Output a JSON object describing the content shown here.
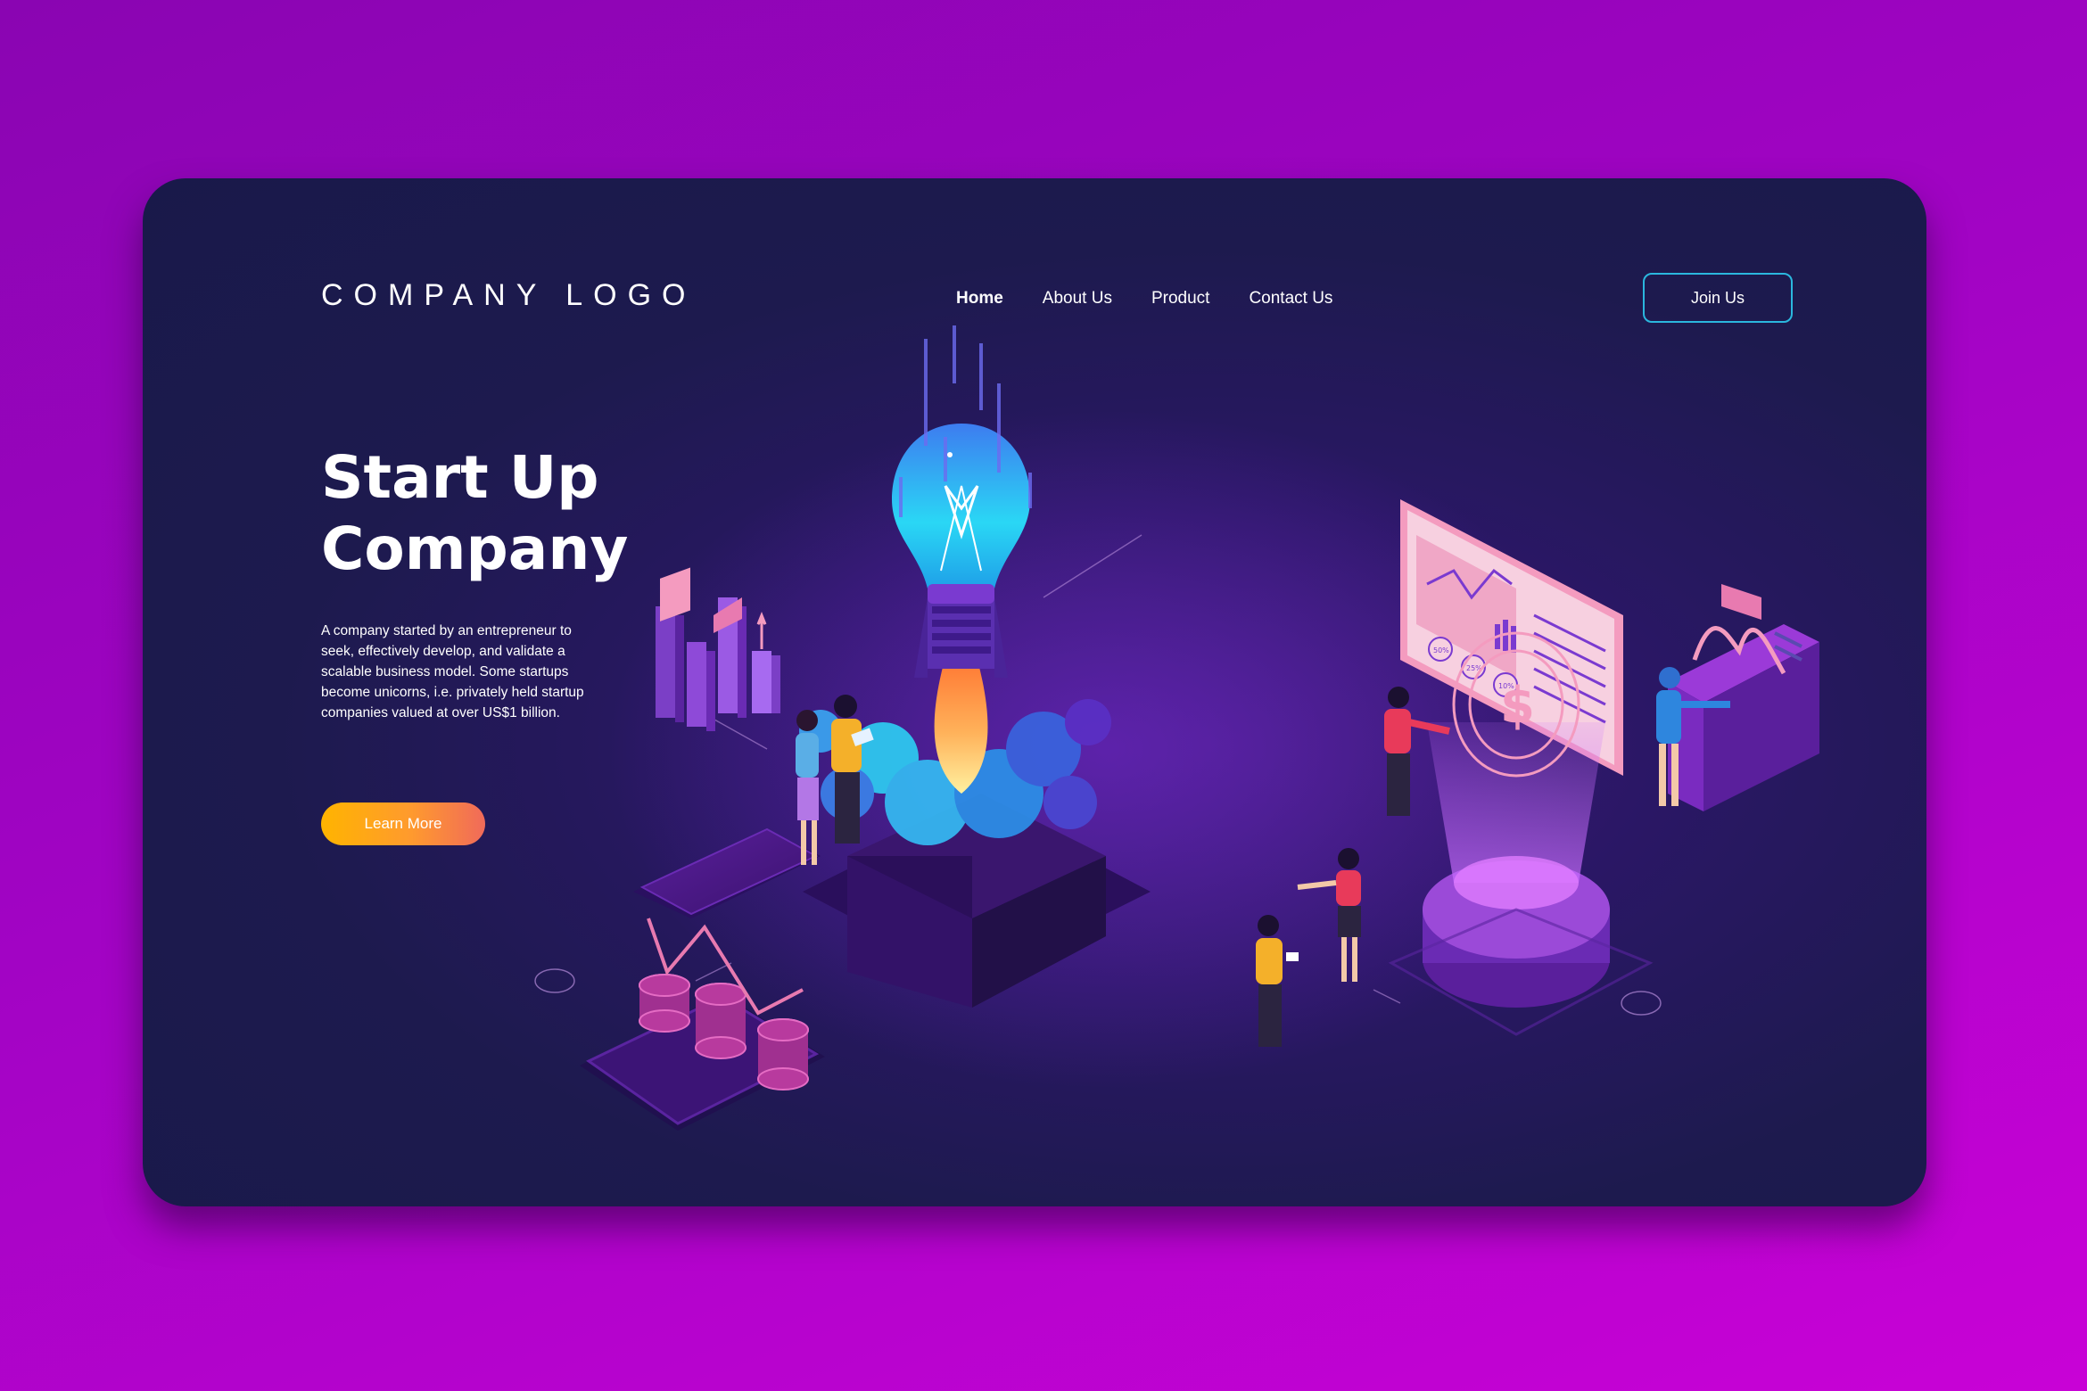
{
  "brand": {
    "logo_text": "COMPANY LOGO"
  },
  "nav": {
    "items": [
      {
        "label": "Home",
        "active": true
      },
      {
        "label": "About Us",
        "active": false
      },
      {
        "label": "Product",
        "active": false
      },
      {
        "label": "Contact Us",
        "active": false
      }
    ]
  },
  "header": {
    "cta_label": "Join Us"
  },
  "hero": {
    "title_line1": "Start Up",
    "title_line2": "Company",
    "description": "A company started by an entrepreneur to seek, effectively develop, and validate a scalable business model. Some startups become unicorns, i.e. privately held startup companies valued at over US$1 billion.",
    "button_label": "Learn More"
  },
  "illustration": {
    "dashboard_badges": [
      "50%",
      "25%",
      "10%"
    ],
    "coin_symbol": "$"
  },
  "colors": {
    "page_background": "#a204c4",
    "card_background": "#1d1a4e",
    "accent_border": "#2bb7de",
    "button_gradient_start": "#ffb400",
    "button_gradient_end": "#f06a5a"
  }
}
